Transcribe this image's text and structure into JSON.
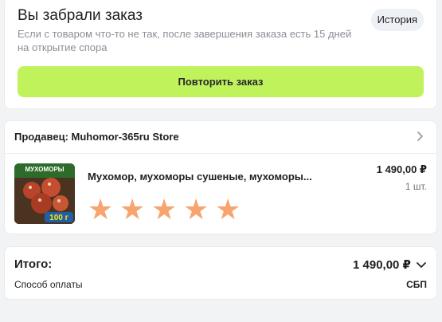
{
  "order": {
    "title": "Вы забрали заказ",
    "subtitle": "Если с товаром что-то не так, после завершения заказа есть 15 дней на открытие спора",
    "history_label": "История",
    "repeat_label": "Повторить заказ"
  },
  "seller": {
    "label": "Продавец: Muhomor-365ru Store"
  },
  "product": {
    "name": "Мухомор, мухоморы сушеные, мухоморы...",
    "price": "1 490,00 ₽",
    "quantity": "1 шт.",
    "rating": 5,
    "image_text": {
      "brand": "МУХОМОРЫ",
      "weight": "100 г"
    }
  },
  "summary": {
    "total_label": "Итого:",
    "total_value": "1 490,00 ₽",
    "payment_label": "Способ оплаты",
    "payment_value": "СБП"
  },
  "colors": {
    "accent": "#c0f25b",
    "star": "#f7a46f"
  }
}
